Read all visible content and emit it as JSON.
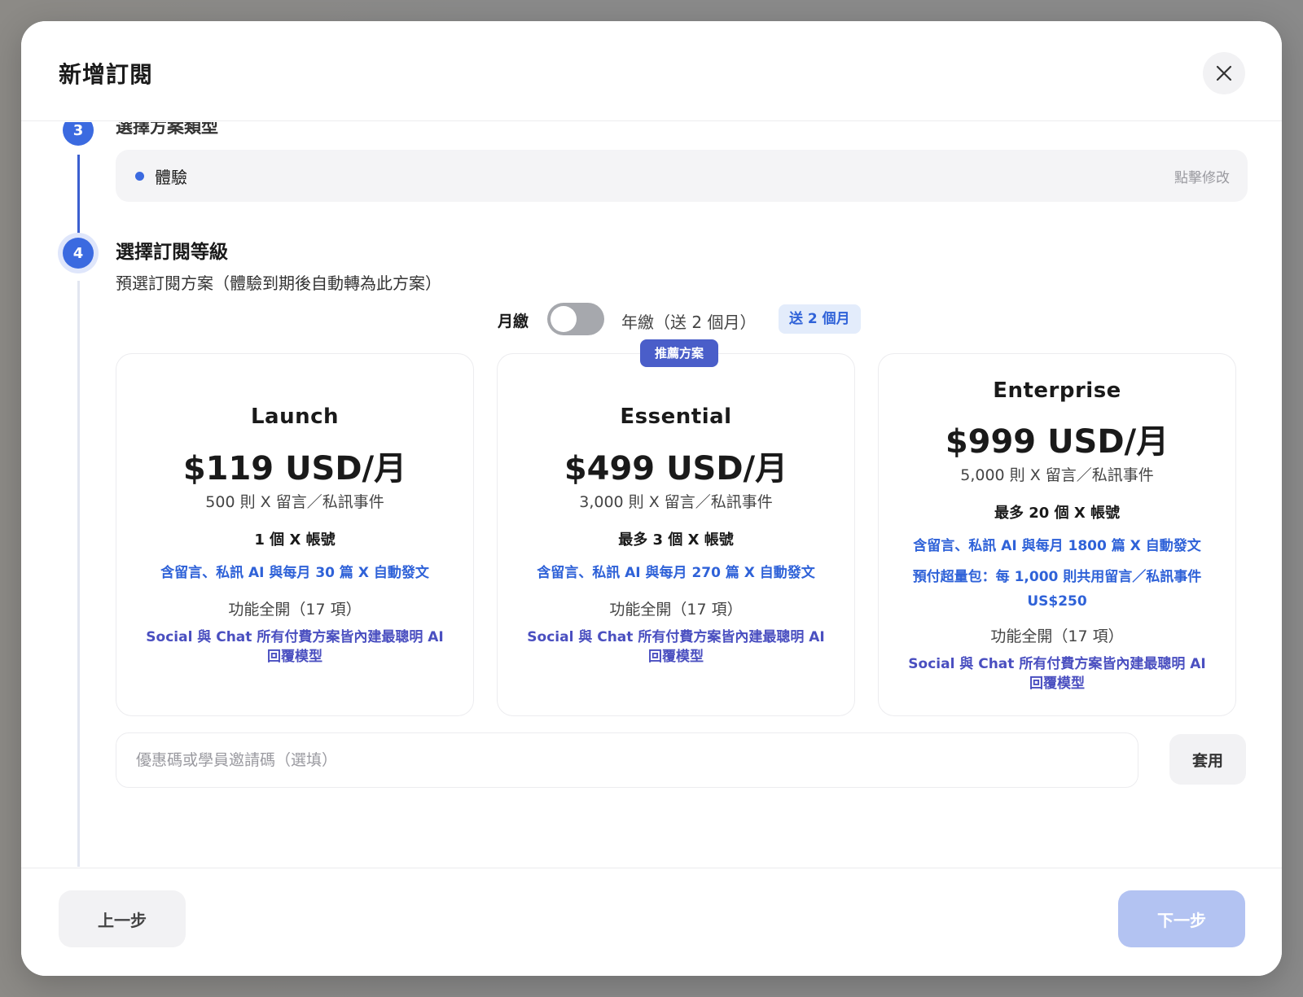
{
  "modal": {
    "title": "新增訂閱",
    "close_icon": "close-icon"
  },
  "step3": {
    "number": "3",
    "title": "選擇方案類型",
    "selected_value": "體驗",
    "edit_label": "點擊修改"
  },
  "step4": {
    "number": "4",
    "title": "選擇訂閱等級",
    "subtitle": "預選訂閱方案（體驗到期後自動轉為此方案）"
  },
  "billing": {
    "monthly_label": "月繳",
    "yearly_label": "年繳（送 2 個月）",
    "bonus_badge": "送 2 個月",
    "toggle_on": false
  },
  "recommend_badge": "推薦方案",
  "plans": [
    {
      "name": "Launch",
      "price": "$119 USD/月",
      "quota": "500 則 X 留言／私訊事件",
      "accounts": "1 個 X 帳號",
      "ai": "含留言、私訊 AI 與每月 30 篇 X 自動發文",
      "features": "功能全開（17 項）",
      "model_line1": "Social 與 Chat 所有付費方案皆內建最聰明 AI",
      "model_line2": "回覆模型"
    },
    {
      "name": "Essential",
      "price": "$499 USD/月",
      "quota": "3,000 則 X 留言／私訊事件",
      "accounts": "最多 3 個 X 帳號",
      "ai": "含留言、私訊 AI 與每月 270 篇 X 自動發文",
      "features": "功能全開（17 項）",
      "model_line1": "Social 與 Chat 所有付費方案皆內建最聰明 AI",
      "model_line2": "回覆模型"
    },
    {
      "name": "Enterprise",
      "price": "$999 USD/月",
      "quota": "5,000 則 X 留言／私訊事件",
      "accounts": "最多 20 個 X 帳號",
      "ai": "含留言、私訊 AI 與每月 1800 篇 X 自動發文",
      "overage_line1": "預付超量包：每 1,000 則共用留言／私訊事件",
      "overage_line2": "US$250",
      "features": "功能全開（17 項）",
      "model_line1": "Social 與 Chat 所有付費方案皆內建最聰明 AI",
      "model_line2": "回覆模型"
    }
  ],
  "coupon": {
    "placeholder": "優惠碼或學員邀請碼（選填）",
    "value": "",
    "apply_label": "套用"
  },
  "footer": {
    "prev_label": "上一步",
    "next_label": "下一步"
  },
  "colors": {
    "accent": "#3b6ae0",
    "link_blue": "#2f62d8",
    "purple": "#4a4fc0",
    "next_disabled": "#b3c3f2"
  }
}
